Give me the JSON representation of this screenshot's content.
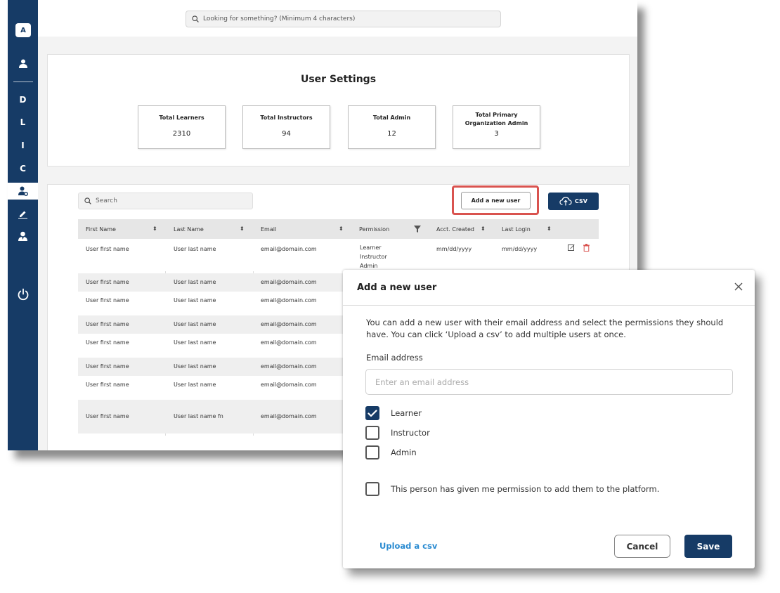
{
  "app": {
    "sidebar": {
      "avatar_letter": "A",
      "letters": [
        "D",
        "L",
        "I",
        "C"
      ]
    },
    "search": {
      "placeholder": "Looking for something? (Minimum 4 characters)"
    }
  },
  "user_settings": {
    "title": "User Settings",
    "stats": [
      {
        "label": "Total Learners",
        "value": "2310"
      },
      {
        "label": "Total Instructors",
        "value": "94"
      },
      {
        "label": "Total Admin",
        "value": "12"
      },
      {
        "label": "Total Primary Organization Admin",
        "value": "3"
      }
    ]
  },
  "table": {
    "search_placeholder": "Search",
    "add_user_label": "Add a new user",
    "csv_label": "CSV",
    "headers": [
      "First Name",
      "Last Name",
      "Email",
      "Permission",
      "Acct. Created",
      "Last Login"
    ],
    "first_row": {
      "first": "User first name",
      "last": "User last name",
      "email": "email@domain.com",
      "permissions": [
        "Learner",
        "Instructor",
        "Admin"
      ],
      "created": "mm/dd/yyyy",
      "login": "mm/dd/yyyy"
    },
    "rows": [
      {
        "first": "User first name",
        "last": "User last name",
        "email": "email@domain.com"
      },
      {
        "first": "User first name",
        "last": "User last name",
        "email": "email@domain.com"
      },
      {
        "first": "User first name",
        "last": "User last name",
        "email": "email@domain.com"
      },
      {
        "first": "User first name",
        "last": "User last name",
        "email": "email@domain.com"
      },
      {
        "first": "User first name",
        "last": "User last name",
        "email": "email@domain.com"
      },
      {
        "first": "User first name",
        "last": "User last name",
        "email": "email@domain.com"
      },
      {
        "first": "User first name",
        "last": "User last name fn",
        "email": "email@domain.com"
      }
    ]
  },
  "modal": {
    "title": "Add a new user",
    "description": "You can add a new user with their email address and select the permissions they should have. You can click ‘Upload a csv’ to add multiple users at once.",
    "email_label": "Email address",
    "email_placeholder": "Enter an email address",
    "permissions": [
      {
        "label": "Learner",
        "checked": true
      },
      {
        "label": "Instructor",
        "checked": false
      },
      {
        "label": "Admin",
        "checked": false
      }
    ],
    "consent_label": "This person has given me permission to add them to the platform.",
    "consent_checked": false,
    "upload_label": "Upload a csv",
    "cancel_label": "Cancel",
    "save_label": "Save"
  },
  "colors": {
    "primary": "#163b66",
    "highlight": "#d9534f",
    "link": "#2a8bd1",
    "delete": "#d9534f"
  }
}
